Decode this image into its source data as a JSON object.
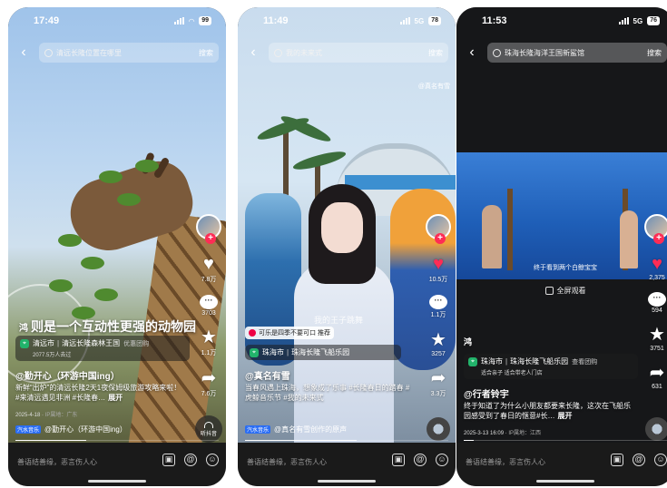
{
  "screens": [
    {
      "time": "17:49",
      "net": "",
      "battery": "99",
      "search_query": "清远长隆位置在哪里",
      "search_btn": "搜索",
      "title_prefix": "鸿",
      "title": "则是一个互动性更强的动物园",
      "poi_city": "清远市",
      "poi_name": "清远长隆森林王国",
      "poi_extra": "优惠团购",
      "poi_sub": "2077.5万人去过",
      "song_tag": "汽水音乐",
      "song": "@勤开心（环游中国ing）",
      "author": "@勤开心（环游中国ing）",
      "desc": "新鲜“出炉”的清远长隆2天1夜保姆级旅游攻略来啦！ #来清远遇见非洲 #长隆春…",
      "more": "展开",
      "date": "2025-4-18",
      "ip": "IP属地：广东",
      "actions": {
        "likes": "7.8万",
        "comments": "3703",
        "stars": "1.1万",
        "shares": "7.6万"
      },
      "listen": "听抖音",
      "progress": 0.35
    },
    {
      "time": "11:49",
      "net": "5G",
      "battery": "78",
      "search_query": "我的未来式",
      "search_btn": "搜索",
      "watermark": "@真名有雪",
      "overlay_text": "我的王子跳舞",
      "hint": "可乐是四季不要可口 推荐",
      "poi_city": "珠海市",
      "poi_name": "珠海长隆飞船乐园",
      "song_tag": "汽水音乐",
      "song": "@真名有雪创作的原声",
      "author": "@真名有雪",
      "desc": "当春风遇上珠海，想象成了乐事 #长隆春日的踏春 #虎鲸音乐节 #我的未来式",
      "actions": {
        "likes": "10.5万",
        "comments": "1.1万",
        "stars": "3257",
        "shares": "3.3万"
      },
      "progress": 0.55
    },
    {
      "time": "11:53",
      "net": "5G",
      "battery": "76",
      "search_query": "珠海长隆海洋王国新鲨馆",
      "search_btn": "搜索",
      "caption_in_video": "终于看到两个白鲸宝宝",
      "fullscreen": "全屏观看",
      "title_prefix": "鸿",
      "poi_city": "珠海市",
      "poi_name": "珠海长隆飞船乐园",
      "poi_extra": "查看团购",
      "poi_sub": "适合亲子 适合带老人门店",
      "author": "@行者铃宇",
      "desc": "终于知道了为什么小朋友都要来长隆，这次在飞船乐园感受到了春日的惬意#长…",
      "more": "展开",
      "date": "2025-3-13 16:09",
      "ip": "IP属地：江西",
      "actions": {
        "likes": "2,375",
        "comments": "594",
        "stars": "3751",
        "shares": "631"
      },
      "progress": 0.05
    }
  ],
  "bottom_placeholder": "善语结善缘，恶言伤人心",
  "icons": {
    "back": "back-arrow-icon",
    "search": "search-icon",
    "like": "heart-icon",
    "comment": "comment-icon",
    "star": "star-icon",
    "share": "share-icon",
    "image": "image-icon",
    "mention": "at-icon",
    "emoji": "emoji-icon"
  },
  "colors": {
    "like_active": "#fe2c55",
    "poi_pin": "#22b36b",
    "bottom_bar": "#1a1a1a"
  }
}
